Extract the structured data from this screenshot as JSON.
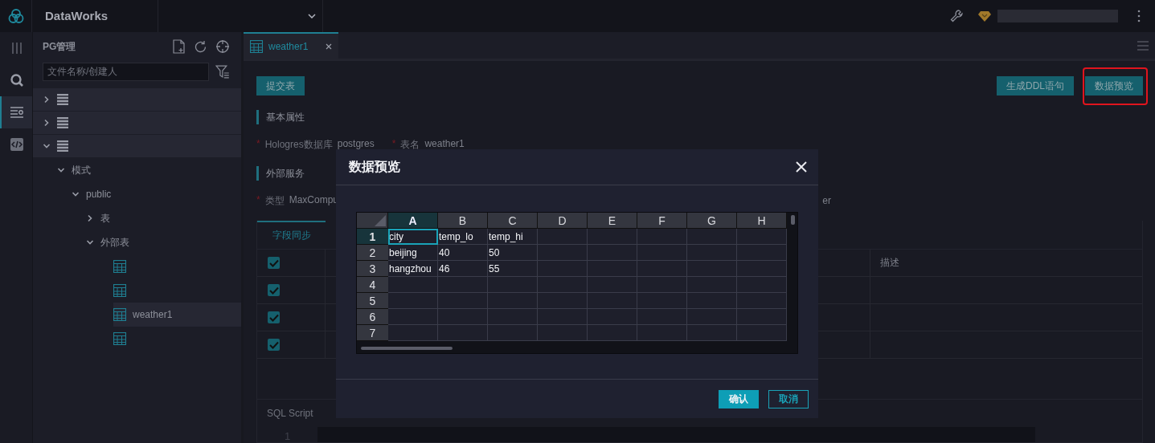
{
  "topbar": {
    "product": "DataWorks"
  },
  "rail": [
    {
      "kind": "panels",
      "selected": false
    },
    {
      "kind": "search",
      "selected": false
    },
    {
      "kind": "list",
      "selected": true
    },
    {
      "kind": "code",
      "selected": false
    }
  ],
  "sidebar": {
    "title": "PG管理",
    "search": {
      "placeholder": "文件名称/创建人"
    },
    "tree": [
      {
        "kind": "database",
        "expanded": false
      },
      {
        "kind": "database",
        "expanded": false
      },
      {
        "kind": "database",
        "expanded": true,
        "children": [
          {
            "kind": "folder",
            "label": "模式",
            "expanded": true,
            "children": [
              {
                "kind": "folder",
                "label": "public",
                "expanded": true,
                "children": [
                  {
                    "kind": "folder",
                    "label": "表",
                    "expanded": false
                  },
                  {
                    "kind": "folder",
                    "label": "外部表",
                    "expanded": true,
                    "children": [
                      {
                        "kind": "table",
                        "selected": false
                      },
                      {
                        "kind": "table",
                        "selected": false
                      },
                      {
                        "kind": "table",
                        "label": "weather1",
                        "selected": true
                      },
                      {
                        "kind": "table",
                        "selected": false
                      }
                    ]
                  }
                ]
              }
            ]
          }
        ]
      }
    ]
  },
  "tabs": [
    {
      "label": "weather1",
      "selected": true
    }
  ],
  "toolbar": {
    "left": [
      {
        "label": "提交表"
      }
    ],
    "right": [
      {
        "label": "生成DDL语句",
        "highlighted": false
      },
      {
        "label": "数据预览",
        "highlighted": true
      }
    ]
  },
  "basic": {
    "title": "基本属性",
    "fields": [
      {
        "marker": "*",
        "label": "Hologres数据库",
        "value": "postgres"
      },
      {
        "marker": "*",
        "label": "表名",
        "value": "weather1"
      }
    ]
  },
  "external": {
    "title": "外部服务",
    "fields": [
      {
        "marker": "*",
        "label": "类型",
        "value": "MaxCompu"
      },
      {
        "value": "er"
      }
    ]
  },
  "sync_panel": {
    "tabs": [
      {
        "label": "字段同步",
        "selected": true
      }
    ],
    "columns": [
      {
        "label": "描述"
      }
    ],
    "select_all": {
      "checked": true
    },
    "rows": [
      {
        "checked": true
      },
      {
        "checked": true
      },
      {
        "checked": true
      }
    ]
  },
  "sql": {
    "title": "SQL Script",
    "line_numbers": [
      "1"
    ]
  },
  "dialog": {
    "title": "数据预览",
    "columns": [
      {
        "label": "A",
        "selected": true
      },
      {
        "label": "B",
        "selected": false
      },
      {
        "label": "C",
        "selected": false
      },
      {
        "label": "D",
        "selected": false
      },
      {
        "label": "E",
        "selected": false
      },
      {
        "label": "F",
        "selected": false
      },
      {
        "label": "G",
        "selected": false
      },
      {
        "label": "H",
        "selected": false
      }
    ],
    "rows": [
      {
        "label": "1",
        "selected": true,
        "cells": [
          "city",
          "temp_lo",
          "temp_hi"
        ]
      },
      {
        "label": "2",
        "selected": false,
        "cells": [
          "beijing",
          "40",
          "50"
        ]
      },
      {
        "label": "3",
        "selected": false,
        "cells": [
          "hangzhou",
          "46",
          "55"
        ]
      },
      {
        "label": "4",
        "selected": false
      },
      {
        "label": "5",
        "selected": false
      },
      {
        "label": "6",
        "selected": false
      },
      {
        "label": "7",
        "selected": false
      }
    ],
    "buttons": [
      {
        "label": "确认",
        "kind": "primary"
      },
      {
        "label": "取消",
        "kind": "secondary"
      }
    ]
  }
}
